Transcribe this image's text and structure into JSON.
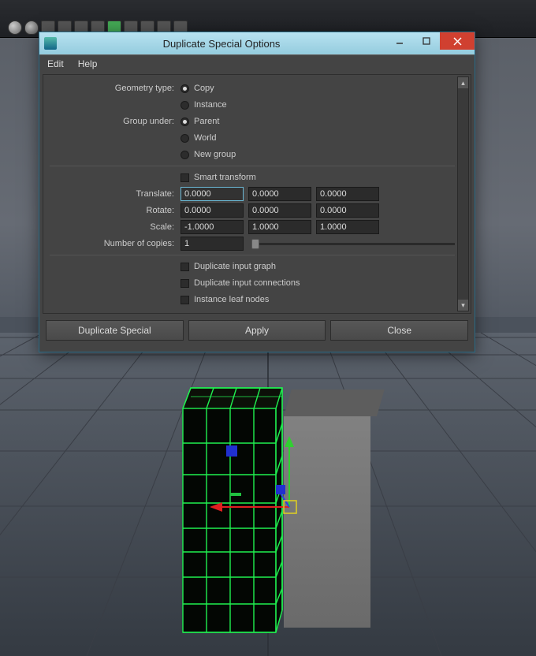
{
  "dialog": {
    "title": "Duplicate Special Options",
    "menu": {
      "edit": "Edit",
      "help": "Help"
    },
    "labels": {
      "geometry_type": "Geometry type:",
      "group_under": "Group under:",
      "smart_transform": "Smart transform",
      "translate": "Translate:",
      "rotate": "Rotate:",
      "scale": "Scale:",
      "copies": "Number of copies:",
      "dup_input_graph": "Duplicate input graph",
      "dup_input_conn": "Duplicate input connections",
      "instance_leaf": "Instance leaf nodes"
    },
    "radios": {
      "copy": "Copy",
      "instance": "Instance",
      "parent": "Parent",
      "world": "World",
      "new_group": "New group"
    },
    "values": {
      "tx": "0.0000",
      "ty": "0.0000",
      "tz": "0.0000",
      "rx": "0.0000",
      "ry": "0.0000",
      "rz": "0.0000",
      "sx": "-1.0000",
      "sy": "1.0000",
      "sz": "1.0000",
      "copies": "1"
    },
    "buttons": {
      "duplicate": "Duplicate Special",
      "apply": "Apply",
      "close": "Close"
    }
  }
}
